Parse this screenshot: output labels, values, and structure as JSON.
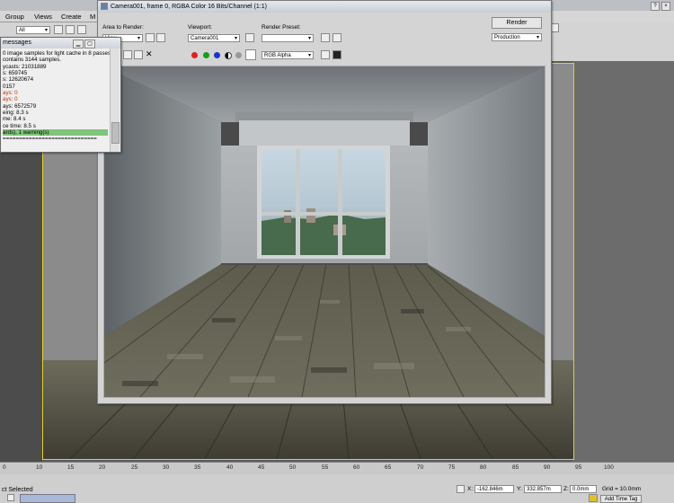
{
  "menu": {
    "items": [
      "Group",
      "Views",
      "Create",
      "M"
    ]
  },
  "toolbar": {
    "selection_filter": "All"
  },
  "right_toolbar": {
    "prompt": "?",
    "close": "×"
  },
  "messages_window": {
    "title": "messages",
    "lines": [
      "0 image samples for light cache in 8 passes.",
      "contains 3144 samples.",
      "ycasts: 21031889",
      "s: 659745",
      "s: 12620674",
      "0157",
      "ays: 0",
      "ays: 0",
      "ays: 6572579",
      "eing: 8.3 s",
      "me: 8.4 s",
      "ce time: 8.5 s",
      "ards), 1 warning(s)",
      "============================="
    ]
  },
  "render_window": {
    "title": "Camera001, frame 0, RGBA Color 16 Bits/Channel (1:1)",
    "area_label": "Area to Render:",
    "area_value": "View",
    "viewport_label": "Viewport:",
    "viewport_value": "Camera001",
    "preset_label": "Render Preset:",
    "preset_value": "",
    "render_button": "Render",
    "production_value": "Production",
    "channel_value": "RGB Alpha"
  },
  "timeline": {
    "ticks": [
      "0",
      "10",
      "15",
      "20",
      "25",
      "30",
      "35",
      "40",
      "45",
      "50",
      "55",
      "60",
      "65",
      "70",
      "75",
      "80",
      "85",
      "90",
      "95",
      "100"
    ]
  },
  "status": {
    "selection": "ct Selected",
    "x_label": "X:",
    "x_value": "-162.846m",
    "y_label": "Y:",
    "y_value": "332.857m",
    "z_label": "Z:",
    "z_value": "0.0mm",
    "grid": "Grid = 10.0mm",
    "add_time_tag": "Add Time Tag"
  }
}
